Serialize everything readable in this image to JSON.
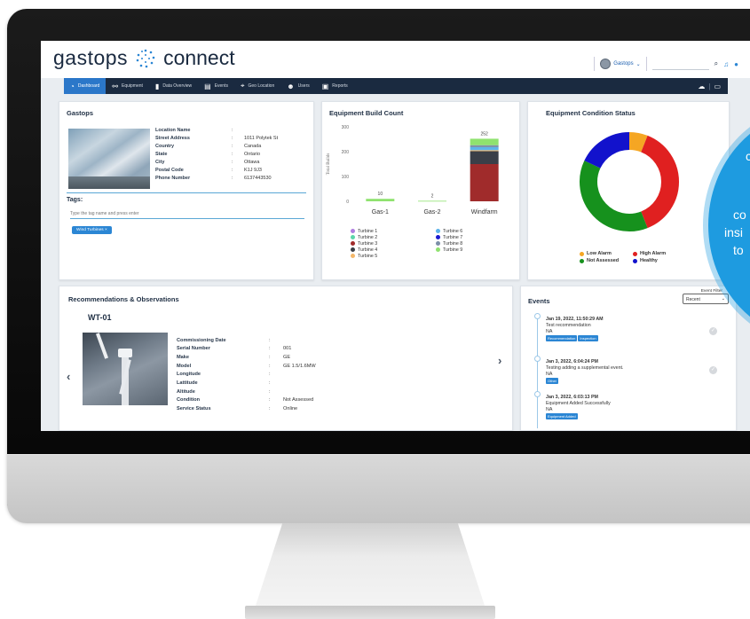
{
  "header": {
    "brand": "gastops",
    "product": "connect",
    "org_name": "Gastops",
    "search_placeholder": ""
  },
  "nav": {
    "items": [
      {
        "label": "Dashboard",
        "active": true
      },
      {
        "label": "Equipment"
      },
      {
        "label": "Data Overview"
      },
      {
        "label": "Events"
      },
      {
        "label": "Geo Location"
      },
      {
        "label": "Users"
      },
      {
        "label": "Reports"
      }
    ]
  },
  "gastops_card": {
    "title": "Gastops",
    "fields": [
      {
        "key": "Location Name",
        "value": ""
      },
      {
        "key": "Street Address",
        "value": "1011 Polytek St"
      },
      {
        "key": "Country",
        "value": "Canada"
      },
      {
        "key": "State",
        "value": "Ontario"
      },
      {
        "key": "City",
        "value": "Ottawa"
      },
      {
        "key": "Postal Code",
        "value": "K1J 9J3"
      },
      {
        "key": "Phone Number",
        "value": "6137443530"
      }
    ],
    "tags_label": "Tags:",
    "tags_placeholder": "Type the tag name and press enter",
    "tag_chip": "Wind Turbines ×"
  },
  "build_card": {
    "title": "Equipment Build Count"
  },
  "chart_data": [
    {
      "type": "bar",
      "title": "Equipment Build Count",
      "ylabel": "Total Builds",
      "ylim": [
        0,
        300
      ],
      "yticks": [
        0,
        100,
        200,
        300
      ],
      "categories": [
        "Gas-1",
        "Gas-2",
        "Windfarm"
      ],
      "totals": [
        10,
        2,
        252
      ],
      "stacked": true,
      "series": [
        {
          "name": "Turbine 1",
          "color": "#b07ee0",
          "values": [
            0,
            0,
            0
          ]
        },
        {
          "name": "Turbine 2",
          "color": "#5cd6a9",
          "values": [
            0,
            0,
            0
          ]
        },
        {
          "name": "Turbine 3",
          "color": "#a02b2b",
          "values": [
            0,
            0,
            150
          ]
        },
        {
          "name": "Turbine 4",
          "color": "#3a3f48",
          "values": [
            0,
            0,
            52
          ]
        },
        {
          "name": "Turbine 5",
          "color": "#f3b76a",
          "values": [
            0,
            0,
            4
          ]
        },
        {
          "name": "Turbine 6",
          "color": "#5db4ea",
          "values": [
            0,
            0,
            12
          ]
        },
        {
          "name": "Turbine 7",
          "color": "#1a1ad0",
          "values": [
            0,
            0,
            0
          ]
        },
        {
          "name": "Turbine 8",
          "color": "#7c8fa8",
          "values": [
            0,
            0,
            8
          ]
        },
        {
          "name": "Turbine 9",
          "color": "#8fe26f",
          "values": [
            10,
            2,
            26
          ]
        }
      ],
      "legend_position": "bottom"
    },
    {
      "type": "pie",
      "title": "Equipment Condition Status",
      "donut": true,
      "categories": [
        "Low Alarm",
        "High Alarm",
        "Not Assessed",
        "Healthy"
      ],
      "values": [
        6,
        38,
        38,
        18
      ],
      "colors": [
        "#f5a623",
        "#e02020",
        "#16911d",
        "#1212cc"
      ],
      "legend_position": "bottom"
    }
  ],
  "condition_card": {
    "title": "Equipment Condition Status",
    "legend": [
      {
        "label": "Low Alarm",
        "color": "#f5a623"
      },
      {
        "label": "High Alarm",
        "color": "#e02020"
      },
      {
        "label": "Not Assessed",
        "color": "#16911d"
      },
      {
        "label": "Healthy",
        "color": "#1212cc"
      }
    ]
  },
  "recs_card": {
    "title": "Recommendations & Observations",
    "equipment_name": "WT-01",
    "fields": [
      {
        "key": "Commissioning Date",
        "value": ""
      },
      {
        "key": "Serial Number",
        "value": "001"
      },
      {
        "key": "Make",
        "value": "GE"
      },
      {
        "key": "Model",
        "value": "GE 1.5/1.6MW"
      },
      {
        "key": "Longitude",
        "value": ""
      },
      {
        "key": "Lattitude",
        "value": ""
      },
      {
        "key": "Altitude",
        "value": ""
      },
      {
        "key": "Condition",
        "value": "Not Assessed"
      },
      {
        "key": "Service Status",
        "value": "Online"
      }
    ]
  },
  "events_card": {
    "title": "Events",
    "filter_label": "Event Filter",
    "filter_value": "Recent",
    "events": [
      {
        "time": "Jan 19, 2022, 11:50:29 AM",
        "desc": "Test recommendation",
        "na": "NA",
        "badges": [
          "Recommendation",
          "Inspection"
        ]
      },
      {
        "time": "Jan 3, 2022, 6:04:24 PM",
        "desc": "Testing adding a supplemental event.",
        "na": "NA",
        "badges": [
          "Other"
        ]
      },
      {
        "time": "Jan 3, 2022, 6:03:13 PM",
        "desc": "Equipment Added Successfully",
        "na": "NA",
        "badges": [
          "Equipment Added"
        ]
      }
    ]
  },
  "overlay": {
    "lines": [
      "c",
      "co",
      "insi",
      "to"
    ]
  }
}
